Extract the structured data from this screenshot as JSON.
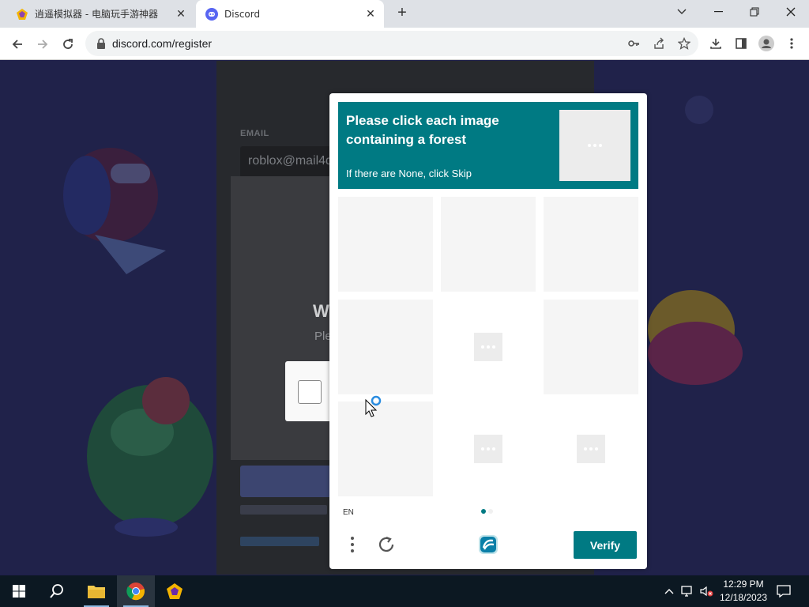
{
  "browser": {
    "tabs": [
      {
        "title": "逍遥模拟器 - 电脑玩手游神器",
        "active": false
      },
      {
        "title": "Discord",
        "active": true
      }
    ],
    "url": "discord.com/register"
  },
  "page": {
    "email_label": "EMAIL",
    "email_value": "roblox@mail4q",
    "modal_heading": "W",
    "modal_sub": "Ple"
  },
  "captcha": {
    "title": "Please click each image containing a forest",
    "subtitle": "If there are None, click Skip",
    "language": "EN",
    "verify_label": "Verify",
    "accent_color": "#007a83",
    "tiles": [
      "empty",
      "empty",
      "empty",
      "empty",
      "loading",
      "empty",
      "empty",
      "loading",
      "loading"
    ]
  },
  "taskbar": {
    "time": "12:29 PM",
    "date": "12/18/2023"
  }
}
